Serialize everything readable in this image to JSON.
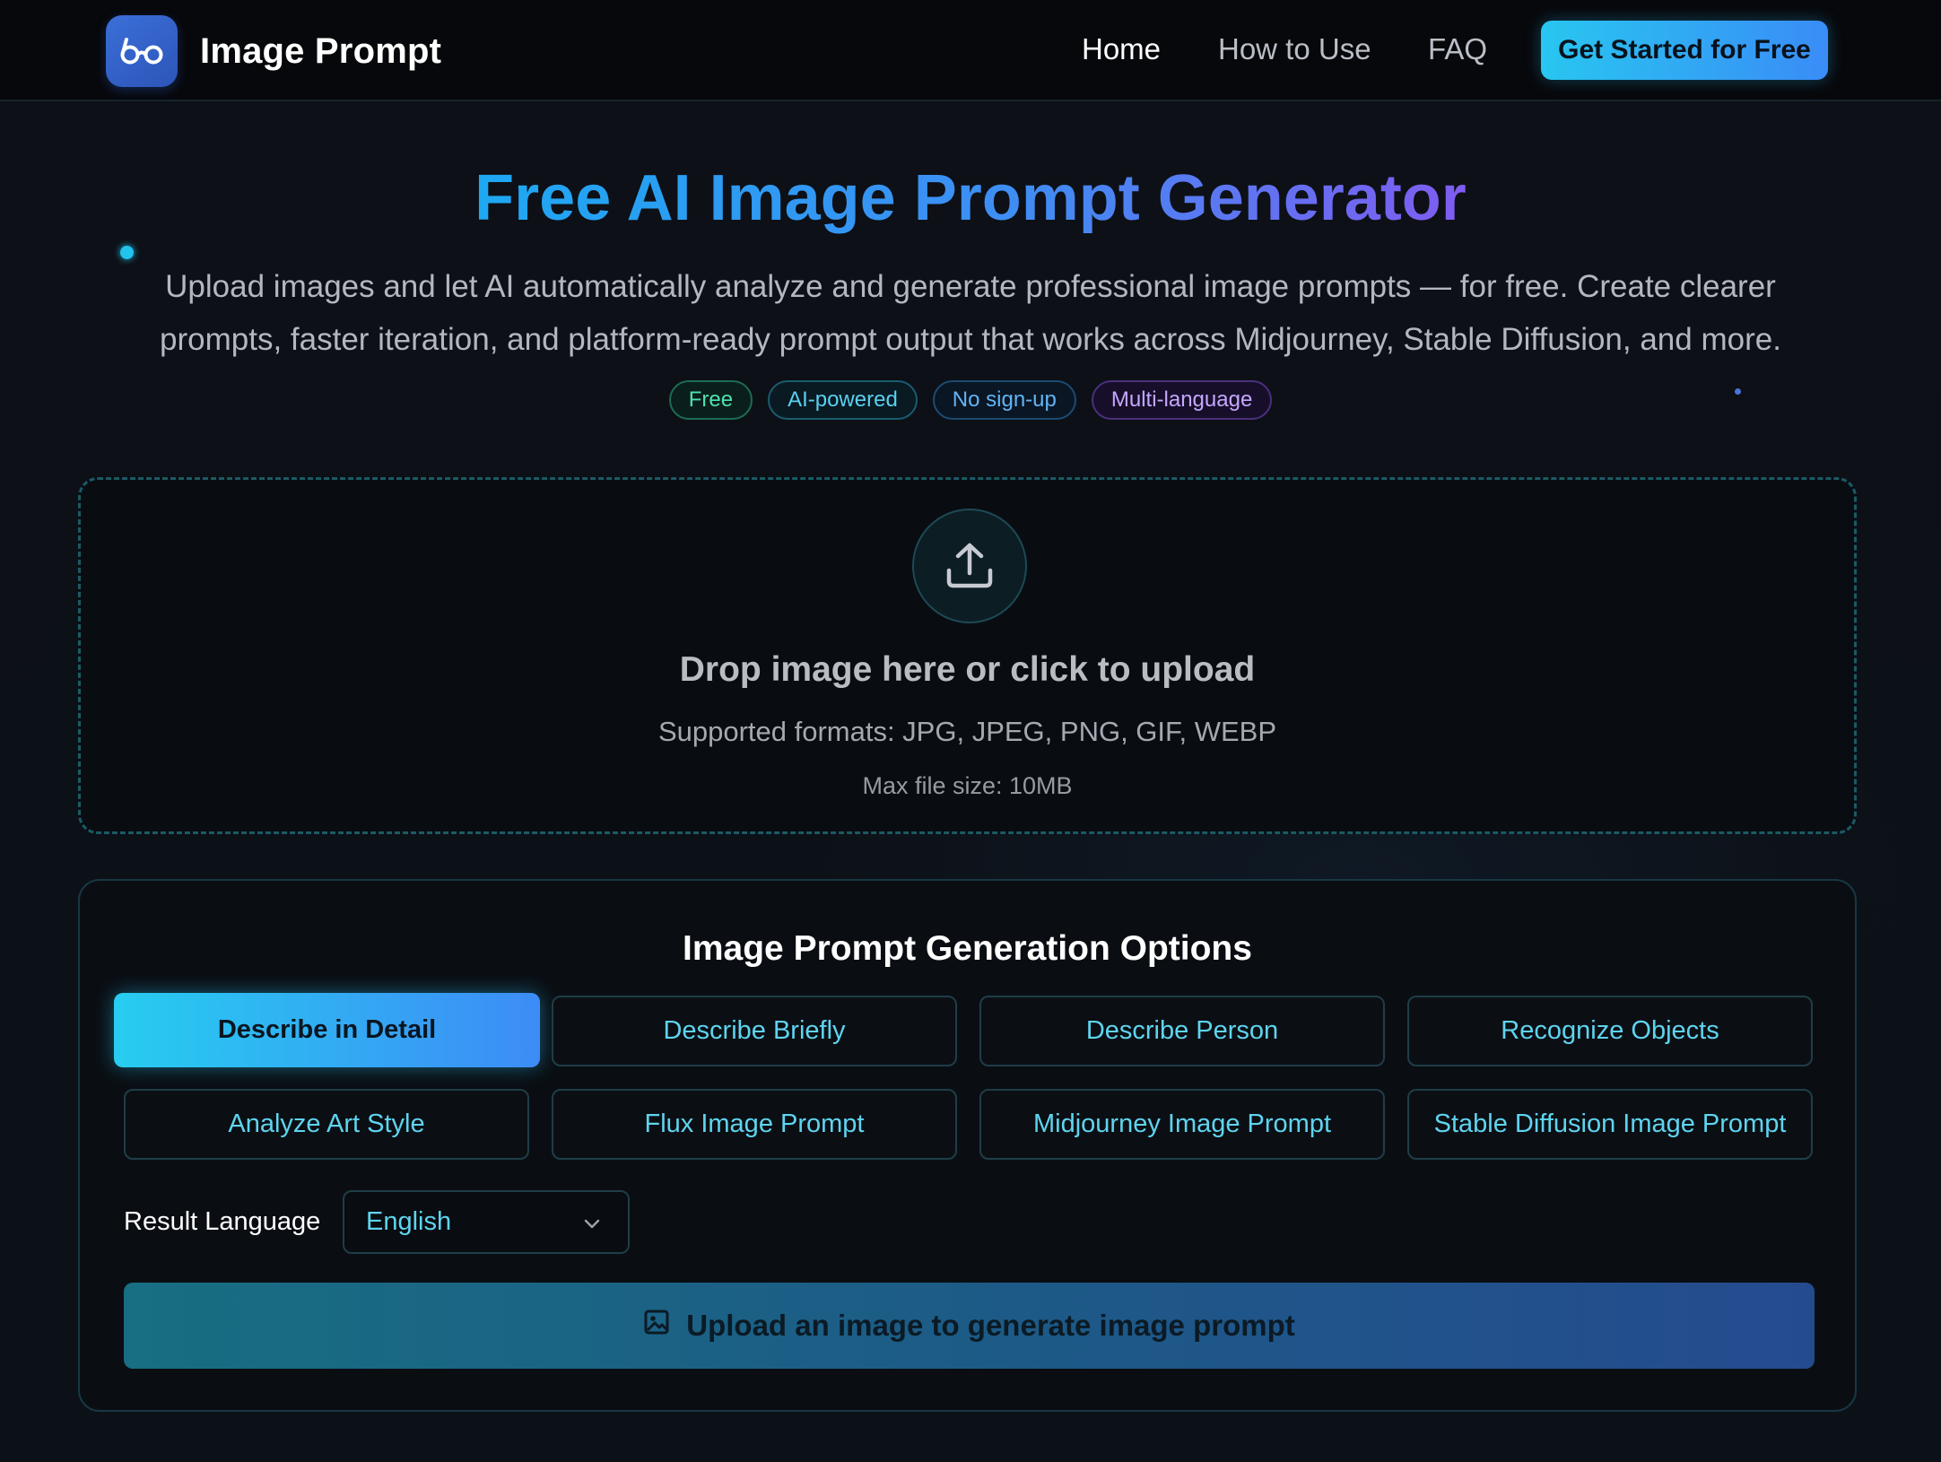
{
  "header": {
    "brand_name": "Image Prompt",
    "logo_icon": "glasses-icon",
    "nav": [
      {
        "label": "Home",
        "active": true
      },
      {
        "label": "How to Use",
        "active": false
      },
      {
        "label": "FAQ",
        "active": false
      }
    ],
    "cta_label": "Get Started for Free"
  },
  "hero": {
    "title": "Free AI Image Prompt Generator",
    "description": "Upload images and let AI automatically analyze and generate professional image prompts — for free. Create clearer prompts, faster iteration, and platform-ready prompt output that works across Midjourney, Stable Diffusion, and more.",
    "tags": [
      "Free",
      "AI-powered",
      "No sign-up",
      "Multi-language"
    ]
  },
  "upload": {
    "icon": "upload-icon",
    "title": "Drop image here or click to upload",
    "formats": "Supported formats: JPG, JPEG, PNG, GIF, WEBP",
    "max_size": "Max file size: 10MB"
  },
  "options": {
    "title": "Image Prompt Generation Options",
    "modes": [
      {
        "label": "Describe in Detail",
        "selected": true
      },
      {
        "label": "Describe Briefly",
        "selected": false
      },
      {
        "label": "Describe Person",
        "selected": false
      },
      {
        "label": "Recognize Objects",
        "selected": false
      },
      {
        "label": "Analyze Art Style",
        "selected": false
      },
      {
        "label": "Flux Image Prompt",
        "selected": false
      },
      {
        "label": "Midjourney Image Prompt",
        "selected": false
      },
      {
        "label": "Stable Diffusion Image Prompt",
        "selected": false
      }
    ],
    "language_label": "Result Language",
    "language_value": "English",
    "generate_label": "Upload an image to generate image prompt"
  },
  "colors": {
    "accent_cyan": "#28c6f0",
    "accent_blue": "#3a8cf7",
    "accent_purple": "#7f5cf0",
    "background": "#0b0e13"
  }
}
